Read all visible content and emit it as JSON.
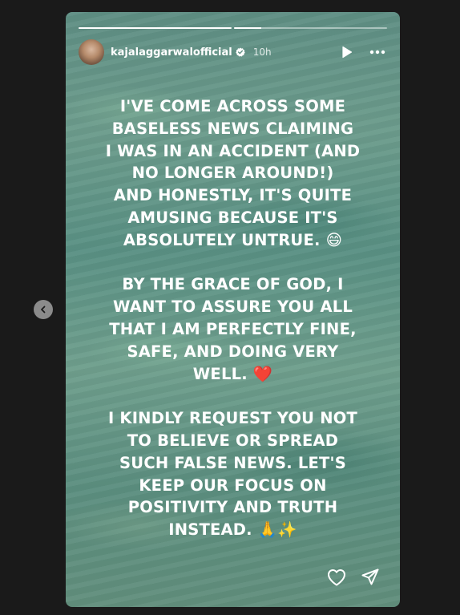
{
  "story": {
    "progress": [
      1.0,
      0.18
    ],
    "username": "kajalaggarwalofficial",
    "verified": true,
    "timestamp": "10h",
    "paragraphs": [
      {
        "lines": [
          "I'VE COME ACROSS SOME",
          "BASELESS NEWS CLAIMING",
          "I WAS IN AN ACCIDENT (AND",
          "NO LONGER AROUND!)",
          "AND HONESTLY, IT'S QUITE",
          "AMUSING BECAUSE IT'S",
          "ABSOLUTELY UNTRUE. 😄"
        ]
      },
      {
        "lines": [
          "BY THE GRACE OF GOD, I",
          "WANT TO ASSURE YOU ALL",
          "THAT I AM PERFECTLY FINE,",
          "SAFE, AND DOING VERY",
          "WELL. ❤️"
        ]
      },
      {
        "lines": [
          "I KINDLY REQUEST YOU NOT",
          "TO BELIEVE OR SPREAD",
          "SUCH FALSE NEWS. LET'S",
          "KEEP OUR FOCUS ON",
          "POSITIVITY AND TRUTH",
          "INSTEAD. 🙏✨"
        ]
      }
    ]
  },
  "icons": {
    "prev": "chevron-left-icon",
    "play": "play-icon",
    "more": "more-horizontal-icon",
    "like": "heart-icon",
    "share": "send-icon",
    "verified": "verified-badge-icon"
  },
  "colors": {
    "page_background": "#1a1a1a",
    "text": "#ffffff",
    "verified_badge": "#ffffff"
  }
}
